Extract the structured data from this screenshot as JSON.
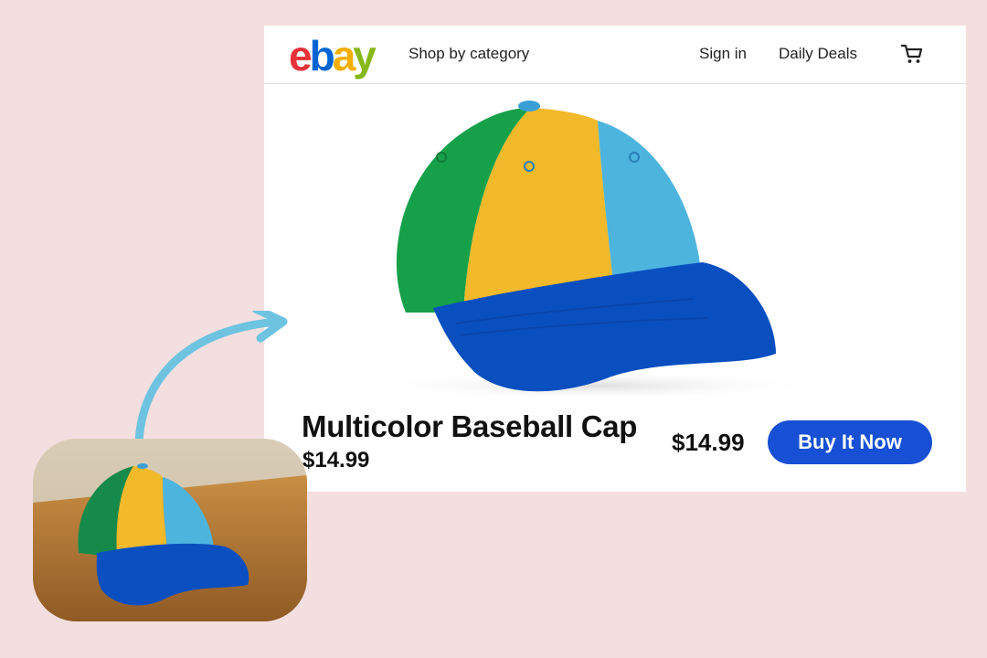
{
  "header": {
    "logo_letters": [
      "e",
      "b",
      "a",
      "y"
    ],
    "shop_by_category": "Shop by category",
    "sign_in": "Sign in",
    "daily_deals": "Daily Deals",
    "cart_icon": "cart-icon"
  },
  "product": {
    "title": "Multicolor Baseball Cap",
    "price": "$14.99",
    "price_side": "$14.99",
    "buy_label": "Buy It Now",
    "colors": {
      "panel_green": "#16a04a",
      "panel_yellow": "#f2b92a",
      "panel_light_blue": "#4db4de",
      "brim_blue": "#0a4fc0"
    }
  },
  "colors": {
    "background": "#f4dfe0",
    "accent": "#1750d4",
    "arrow": "#6ec3e0"
  }
}
